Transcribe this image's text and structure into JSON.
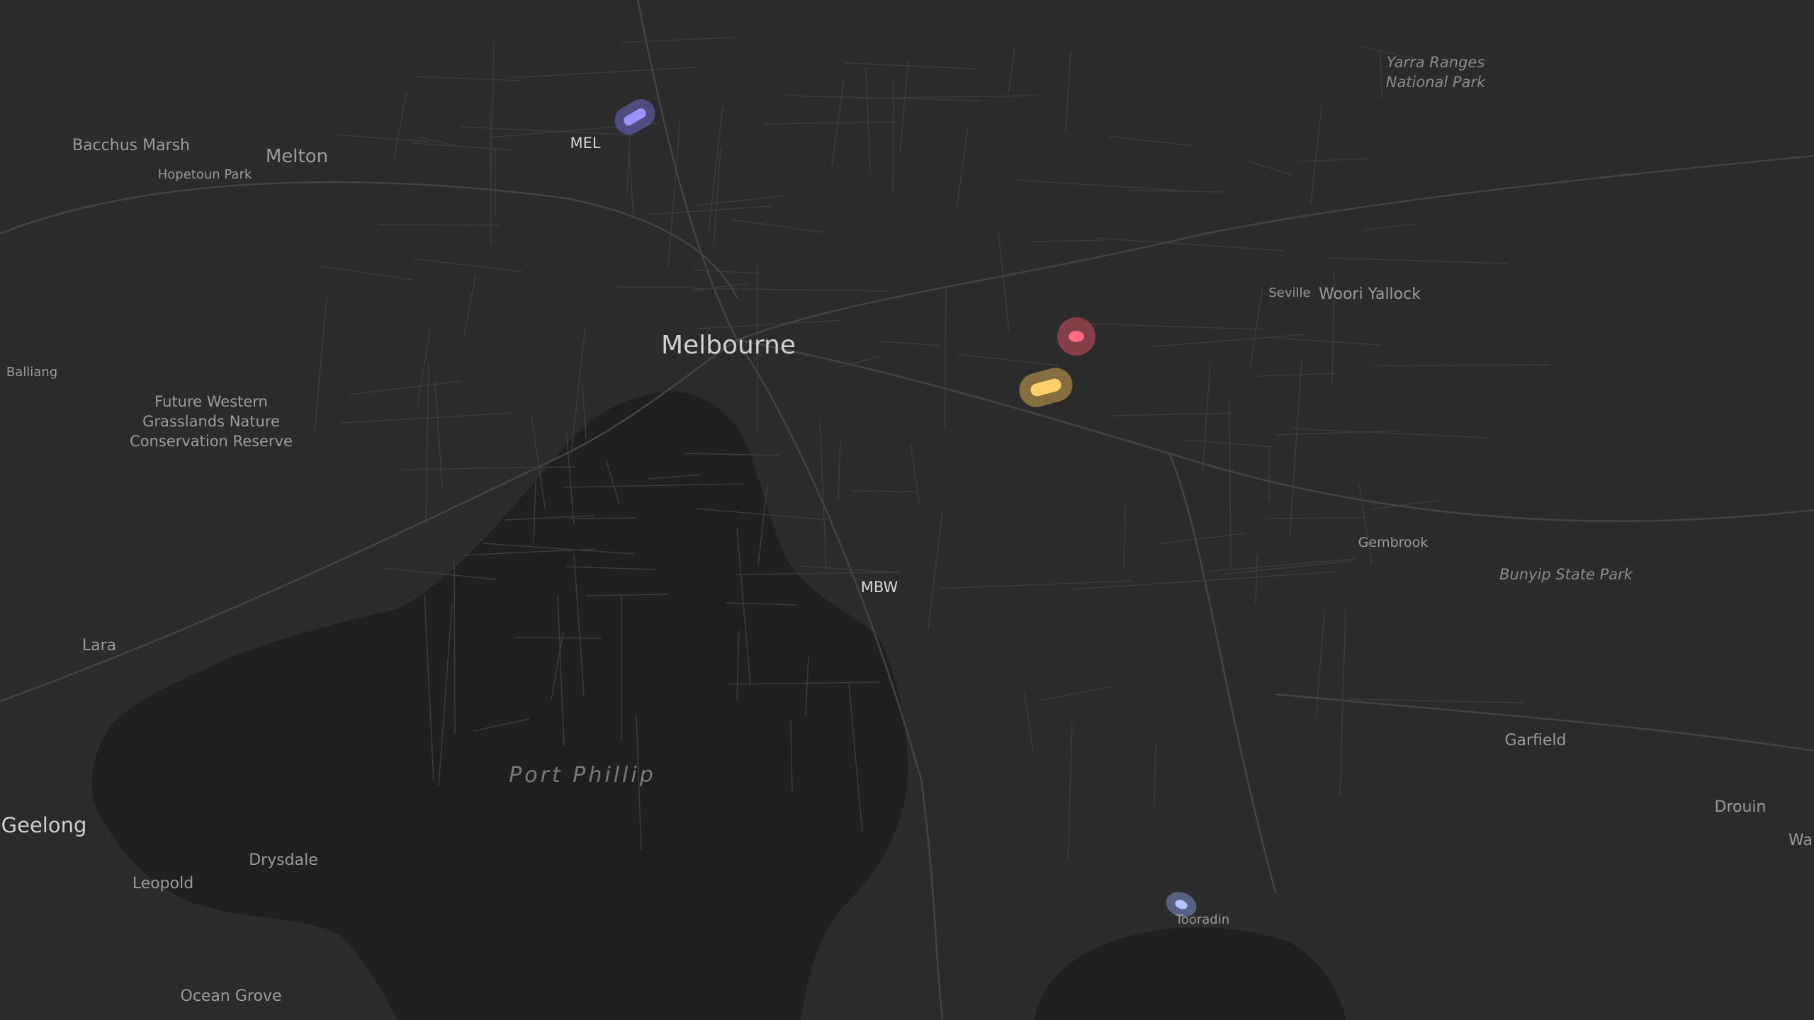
{
  "map": {
    "labels": {
      "melbourne": "Melbourne",
      "mel": "MEL",
      "mbw": "MBW",
      "port_phillip": "Port Phillip",
      "bacchus_marsh": "Bacchus Marsh",
      "melton": "Melton",
      "hopetoun_park": "Hopetoun Park",
      "balliang": "Balliang",
      "future_western_1": "Future Western",
      "future_western_2": "Grasslands Nature",
      "future_western_3": "Conservation Reserve",
      "lara": "Lara",
      "geelong": "Geelong",
      "leopold": "Leopold",
      "drysdale": "Drysdale",
      "ocean_grove": "Ocean Grove",
      "yarra_ranges_1": "Yarra Ranges",
      "yarra_ranges_2": "National Park",
      "seville": "Seville",
      "woori_yallock": "Woori Yallock",
      "gembrook": "Gembrook",
      "bunyip": "Bunyip State Park",
      "garfield": "Garfield",
      "drouin": "Drouin",
      "wa": "Wa",
      "tooradin": "Tooradin"
    },
    "markers": [
      {
        "name": "marker-purple",
        "color": "#7b73e6"
      },
      {
        "name": "marker-red",
        "color": "#f0566b"
      },
      {
        "name": "marker-yellow",
        "color": "#f4c15a"
      },
      {
        "name": "marker-blue",
        "color": "#8fa6f0"
      }
    ],
    "colors": {
      "land": "#2b2b2b",
      "water": "#1e1e1e",
      "road": "#3d3d3d"
    }
  }
}
